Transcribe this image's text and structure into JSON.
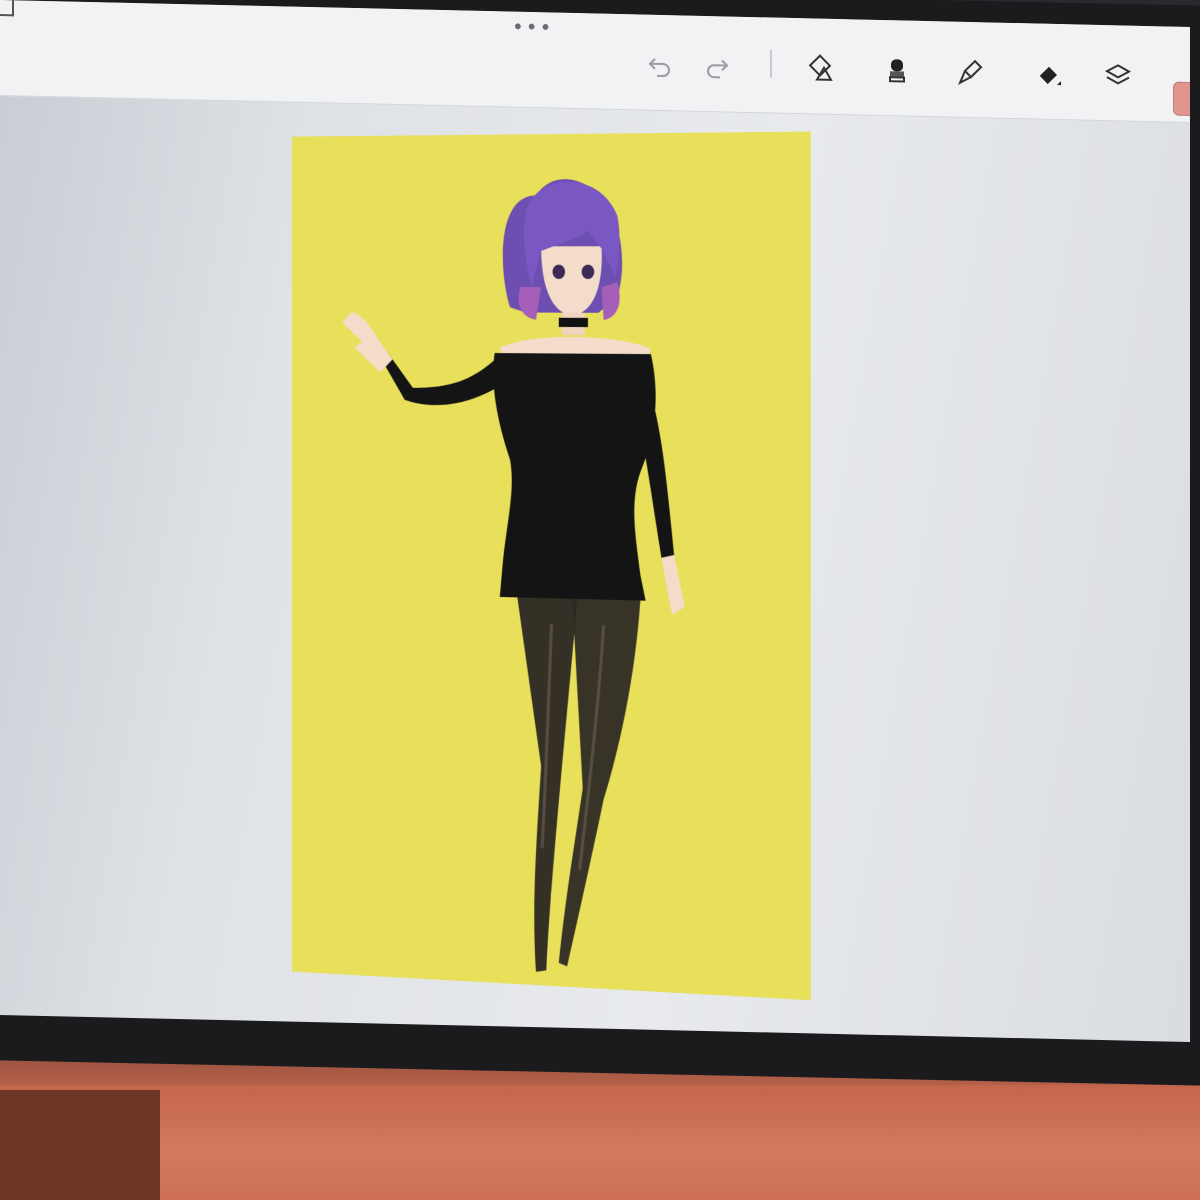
{
  "app": {
    "toolbar": {
      "tools": [
        {
          "name": "undo",
          "icon": "undo-icon"
        },
        {
          "name": "redo",
          "icon": "redo-icon"
        },
        {
          "name": "shapes",
          "icon": "shapes-icon"
        },
        {
          "name": "brush",
          "icon": "brush-icon"
        },
        {
          "name": "smudge",
          "icon": "smudge-icon"
        },
        {
          "name": "eraser",
          "icon": "eraser-icon"
        },
        {
          "name": "layers",
          "icon": "layers-icon"
        }
      ],
      "current_color": "#e0958e"
    },
    "canvas": {
      "background_color": "#e8df5a"
    }
  }
}
